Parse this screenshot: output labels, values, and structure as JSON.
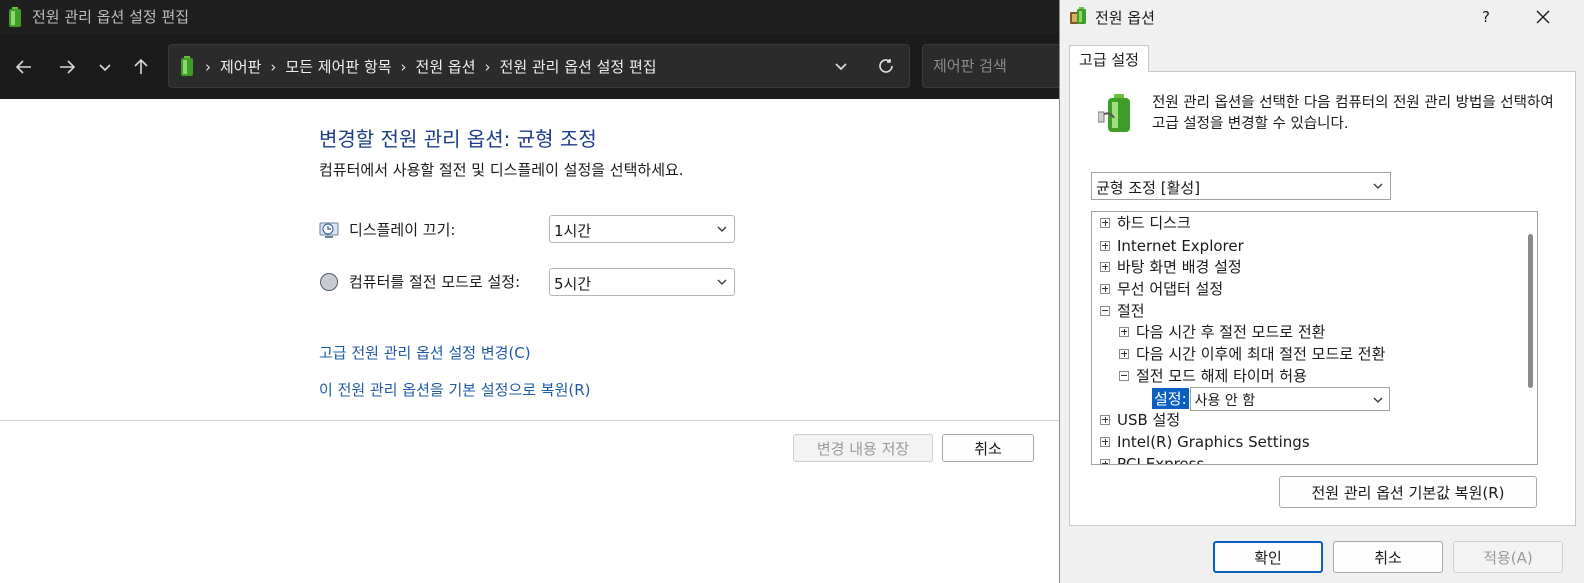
{
  "window": {
    "title": "전원 관리 옵션 설정 편집"
  },
  "addressbar": {
    "crumbs": [
      "제어판",
      "모든 제어판 항목",
      "전원 옵션",
      "전원 관리 옵션 설정 편집"
    ]
  },
  "search": {
    "placeholder": "제어판 검색"
  },
  "content": {
    "title": "변경할 전원 관리 옵션: 균형 조정",
    "subtitle": "컴퓨터에서 사용할 절전 및 디스플레이 설정을 선택하세요.",
    "display_off_label": "디스플레이 끄기:",
    "display_off_value": "1시간",
    "sleep_label": "컴퓨터를 절전 모드로 설정:",
    "sleep_value": "5시간",
    "advanced_link": "고급 전원 관리 옵션 설정 변경(C)",
    "restore_link": "이 전원 관리 옵션을 기본 설정으로 복원(R)",
    "save_button": "변경 내용 저장",
    "cancel_button": "취소"
  },
  "dialog": {
    "title": "전원 옵션",
    "help": "?",
    "tab": "고급 설정",
    "intro": "전원 관리 옵션을 선택한 다음 컴퓨터의 전원 관리 방법을 선택하여 고급 설정을 변경할 수 있습니다.",
    "plan_value": "균형 조정 [활성]",
    "tree": {
      "hard_disk": "하드 디스크",
      "ie": "Internet Explorer",
      "desktop_bg": "바탕 화면 배경 설정",
      "wireless": "무선 어댑터 설정",
      "sleep": "절전",
      "sleep_after": "다음 시간 후 절전 모드로 전환",
      "hibernate_after": "다음 시간 이후에 최대 절전 모드로 전환",
      "wake_timers": "절전 모드 해제 타이머 허용",
      "setting_label": "설정:",
      "setting_value": "사용 안 함",
      "usb": "USB 설정",
      "intel_graphics": "Intel(R) Graphics Settings",
      "pci_express": "PCI Express"
    },
    "restore_defaults_button": "전원 관리 옵션 기본값 복원(R)",
    "ok_button": "확인",
    "cancel_button": "취소",
    "apply_button": "적용(A)"
  },
  "colors": {
    "title_bar": "#1f1f1f",
    "nav_bar": "#1b1b1b",
    "page_title": "#1e3c8c",
    "link": "#1f5aa6",
    "selection": "#0a5fc1"
  }
}
